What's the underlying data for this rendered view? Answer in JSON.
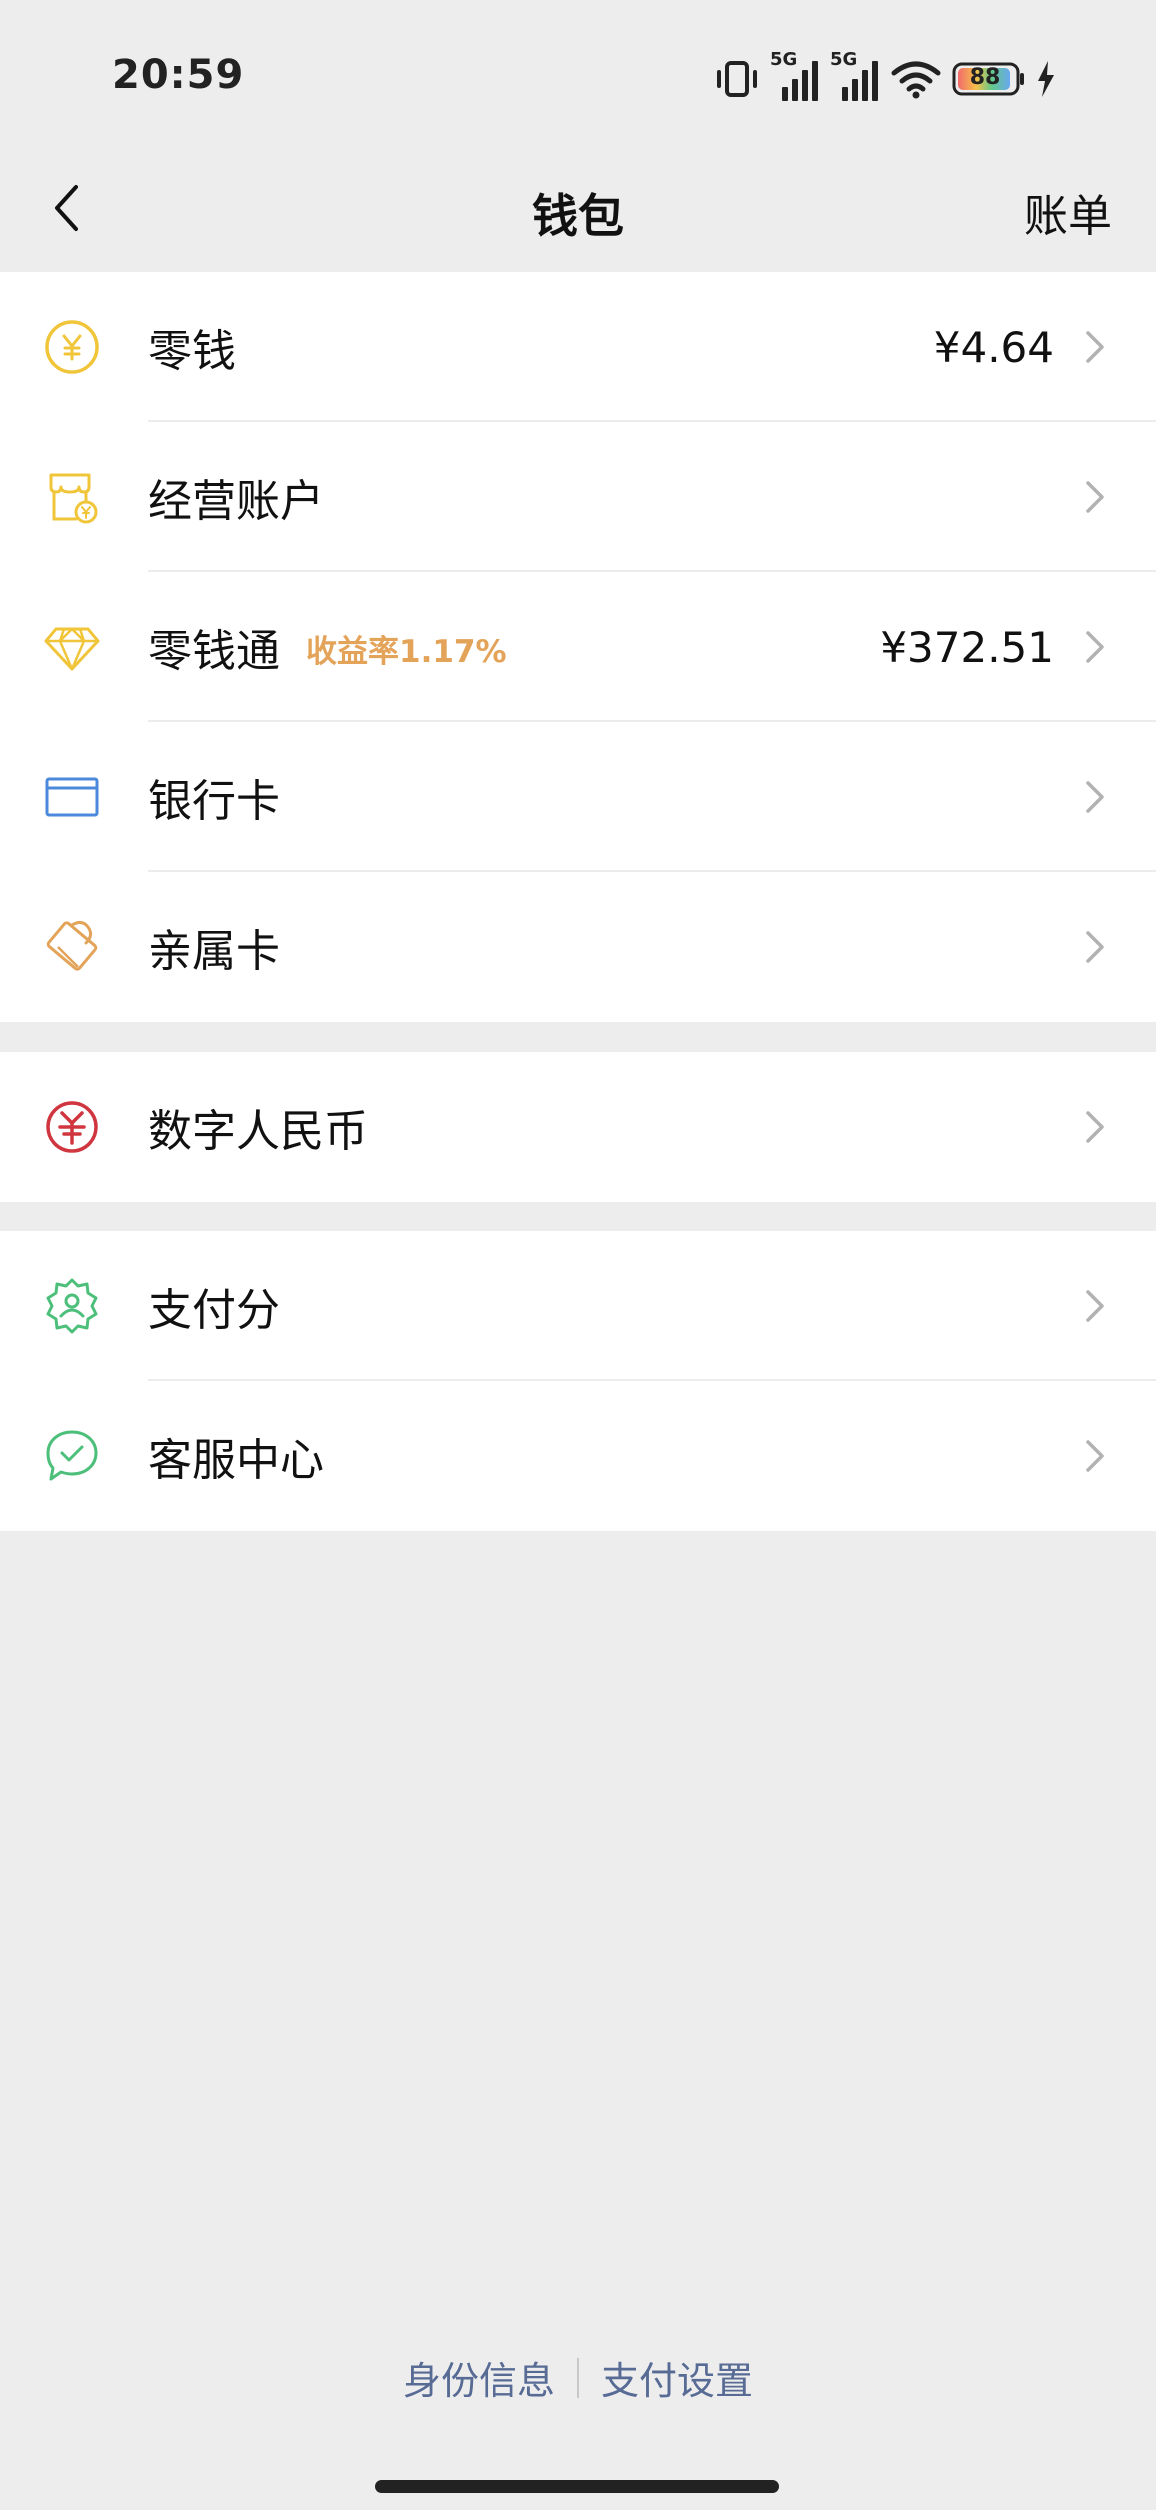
{
  "status_bar": {
    "time": "20:59",
    "network_1": "5G",
    "network_2": "5G",
    "battery": "88"
  },
  "nav": {
    "title": "钱包",
    "action": "账单"
  },
  "groups": [
    {
      "items": [
        {
          "label": "零钱",
          "value": "¥4.64",
          "icon": "coin-icon",
          "color": "#f0c53a"
        },
        {
          "label": "经营账户",
          "value": "",
          "icon": "store-icon",
          "color": "#f0c53a"
        },
        {
          "label": "零钱通",
          "tag": "收益率1.17%",
          "value": "¥372.51",
          "icon": "diamond-icon",
          "color": "#f0c53a"
        },
        {
          "label": "银行卡",
          "value": "",
          "icon": "card-icon",
          "color": "#4a89dc"
        },
        {
          "label": "亲属卡",
          "value": "",
          "icon": "family-card-icon",
          "color": "#e3a359"
        }
      ]
    },
    {
      "items": [
        {
          "label": "数字人民币",
          "value": "",
          "icon": "digital-yuan-icon",
          "color": "#d0363f"
        }
      ]
    },
    {
      "items": [
        {
          "label": "支付分",
          "value": "",
          "icon": "pay-score-icon",
          "color": "#4cbf7a"
        },
        {
          "label": "客服中心",
          "value": "",
          "icon": "customer-service-icon",
          "color": "#4cbf7a"
        }
      ]
    }
  ],
  "footer": {
    "link_identity": "身份信息",
    "link_settings": "支付设置"
  }
}
